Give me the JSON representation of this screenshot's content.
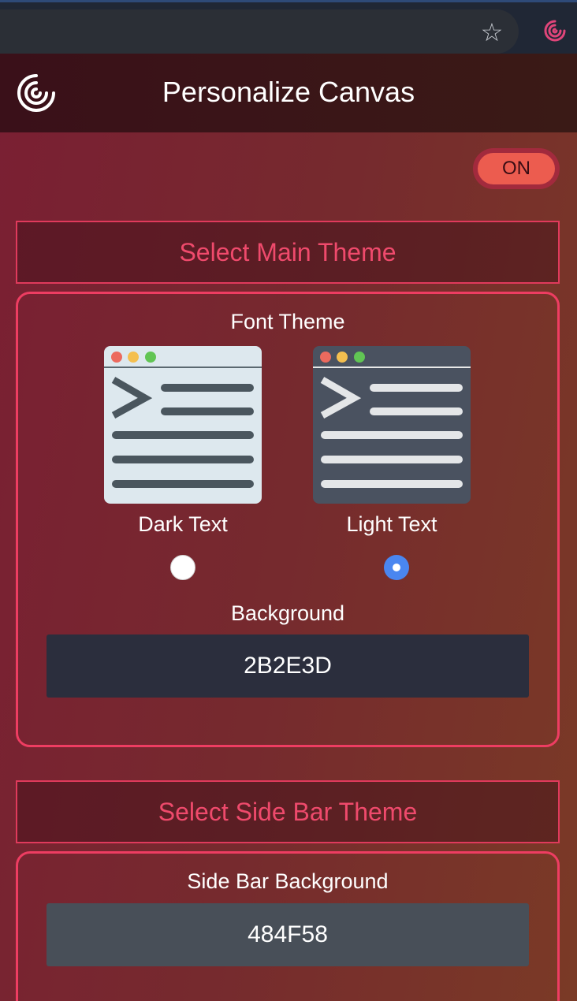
{
  "browser": {
    "star_icon": "star-icon",
    "extension_icon": "canvas-extension-icon"
  },
  "header": {
    "title": "Personalize Canvas",
    "logo_icon": "canvas-logo-icon"
  },
  "toggle": {
    "label": "ON",
    "state": "on"
  },
  "main_theme": {
    "section_title": "Select Main Theme",
    "font_theme_label": "Font Theme",
    "options": [
      {
        "label": "Dark Text",
        "selected": false,
        "icon": "dark-text-preview-icon"
      },
      {
        "label": "Light Text",
        "selected": true,
        "icon": "light-text-preview-icon"
      }
    ],
    "background_label": "Background",
    "background_value": "2B2E3D",
    "background_color": "#2B2E3D"
  },
  "side_bar_theme": {
    "section_title": "Select Side Bar Theme",
    "background_label": "Side Bar Background",
    "background_value": "484F58",
    "background_color": "#484F58"
  },
  "colors": {
    "accent": "#EE3D62",
    "toggle_on": "#EC5C4F",
    "radio_selected": "#4A86F0"
  }
}
